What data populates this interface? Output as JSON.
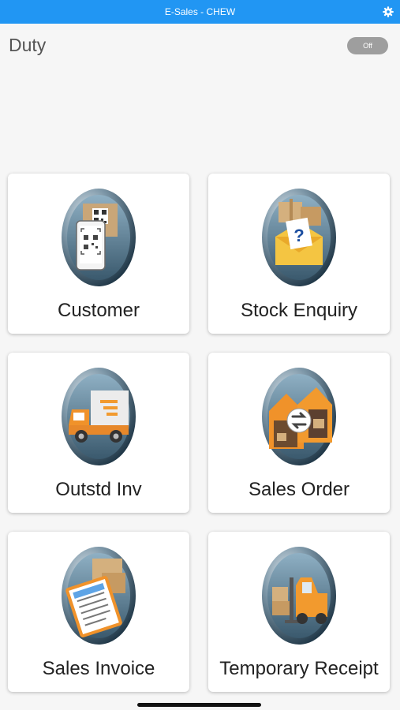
{
  "window": {
    "title": "E-Sales - CHEW",
    "settings_icon": "gear-icon"
  },
  "duty": {
    "label": "Duty",
    "toggle_text": "Off",
    "toggle_on": false
  },
  "menu": {
    "items": [
      {
        "label": "Customer",
        "icon": "qr-code-phone-icon"
      },
      {
        "label": "Stock Enquiry",
        "icon": "stock-enquiry-icon"
      },
      {
        "label": "Outstd Inv",
        "icon": "delivery-truck-icon"
      },
      {
        "label": "Sales Order",
        "icon": "warehouse-transfer-icon"
      },
      {
        "label": "Sales Invoice",
        "icon": "invoice-clipboard-icon"
      },
      {
        "label": "Temporary Receipt",
        "icon": "forklift-icon"
      }
    ]
  },
  "colors": {
    "header": "#2196f3",
    "toggle_off": "#9e9e9e",
    "icon_frame": "#3d5d72"
  }
}
